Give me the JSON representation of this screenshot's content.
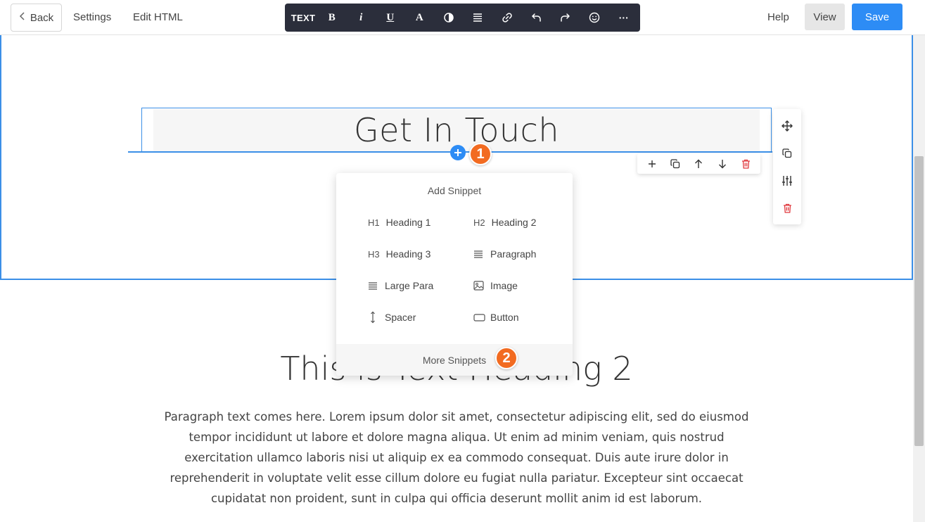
{
  "topbar": {
    "back_label": "Back",
    "settings_label": "Settings",
    "edit_html_label": "Edit HTML",
    "help_label": "Help",
    "view_label": "View",
    "save_label": "Save"
  },
  "toolbar": {
    "text_label": "TEXT",
    "bold_label": "B",
    "italic_label": "i",
    "underline_label": "U",
    "color_label": "A",
    "more_label": "···"
  },
  "canvas": {
    "heading1": "Get In Touch",
    "heading2": "This is Text Heading 2",
    "paragraph": "Paragraph text comes here. Lorem ipsum dolor sit amet, consectetur adipiscing elit, sed do eiusmod tempor incididunt ut labore et dolore magna aliqua. Ut enim ad minim veniam, quis nostrud exercitation ullamco laboris nisi ut aliquip ex ea commodo consequat. Duis aute irure dolor in reprehenderit in voluptate velit esse cillum dolore eu fugiat nulla pariatur. Excepteur sint occaecat cupidatat non proident, sunt in culpa qui officia deserunt mollit anim id est laborum."
  },
  "snippet_panel": {
    "title": "Add Snippet",
    "items": [
      {
        "tag": "H1",
        "label": "Heading 1"
      },
      {
        "tag": "H2",
        "label": "Heading 2"
      },
      {
        "tag": "H3",
        "label": "Heading 3"
      },
      {
        "tag": "",
        "label": "Paragraph"
      },
      {
        "tag": "",
        "label": "Large Para"
      },
      {
        "tag": "",
        "label": "Image"
      },
      {
        "tag": "",
        "label": "Spacer"
      },
      {
        "tag": "",
        "label": "Button"
      }
    ],
    "more_label": "More Snippets"
  },
  "badges": {
    "step1": "1",
    "step2": "2"
  },
  "colors": {
    "accent": "#2d8cf5",
    "selection": "#3b8fe7",
    "badge": "#f26b21",
    "toolbar_bg": "#2b2e3b",
    "delete": "#e0393e"
  }
}
